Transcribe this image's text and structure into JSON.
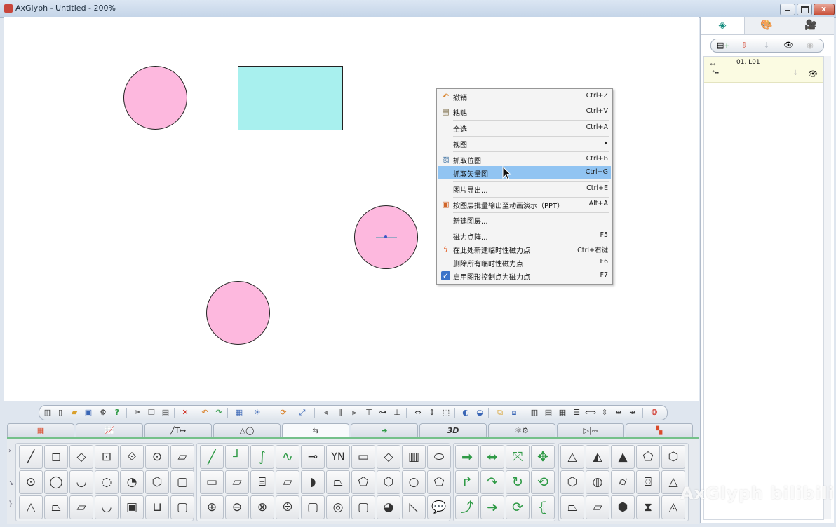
{
  "window": {
    "title": "AxGlyph - Untitled - 200%"
  },
  "context_menu": {
    "items": [
      {
        "label": "撤销",
        "shortcut": "Ctrl+Z",
        "icon": "undo-icon"
      },
      {
        "label": "粘贴",
        "shortcut": "Ctrl+V",
        "icon": "paste-icon"
      },
      {
        "label": "全选",
        "shortcut": "Ctrl+A"
      },
      {
        "label": "视图",
        "shortcut": "",
        "submenu": true
      },
      {
        "label": "抓取位图",
        "shortcut": "Ctrl+B",
        "icon": "bitmap-icon"
      },
      {
        "label": "抓取矢量图",
        "shortcut": "Ctrl+G",
        "highlighted": true
      },
      {
        "label": "图片导出...",
        "shortcut": "Ctrl+E"
      },
      {
        "label": "按图层批量输出至动画演示（PPT）",
        "shortcut": "Alt+A",
        "icon": "ppt-icon"
      },
      {
        "label": "新建图层...",
        "shortcut": ""
      },
      {
        "label": "磁力点阵...",
        "shortcut": "F5"
      },
      {
        "label": "在此处新建临时性磁力点",
        "shortcut": "Ctrl+右键",
        "icon": "lightning-icon"
      },
      {
        "label": "删除所有临时性磁力点",
        "shortcut": "F6"
      },
      {
        "label": "启用图形控制点为磁力点",
        "shortcut": "F7",
        "checked": true
      }
    ]
  },
  "layers_panel": {
    "layers": [
      {
        "name": "01. L01"
      }
    ]
  },
  "colors": {
    "circle_fill": "#fdb8de",
    "rect_fill": "#a8f0ee",
    "highlight": "#91c4f2",
    "accent_green": "#2f9a46"
  },
  "palette": {
    "row_text_cell": "YN"
  },
  "watermark": "AxGlyph bilibili"
}
